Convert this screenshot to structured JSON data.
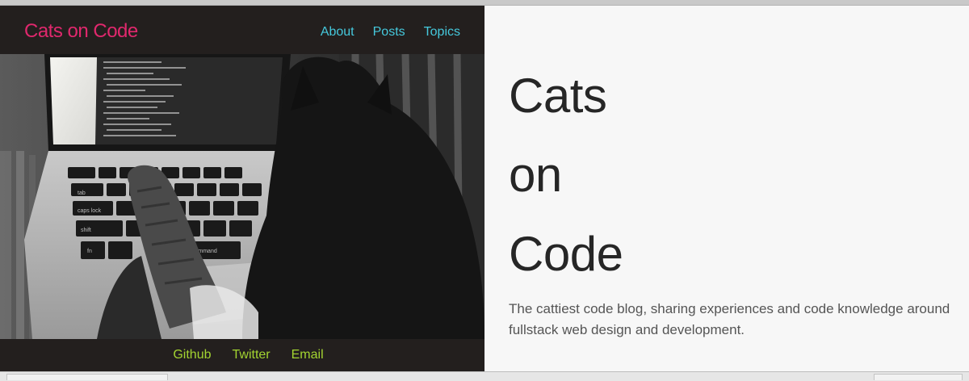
{
  "site": {
    "brand": "Cats on Code",
    "nav": [
      "About",
      "Posts",
      "Topics"
    ],
    "footer_links": [
      "Github",
      "Twitter",
      "Email"
    ],
    "title_words": [
      "Cats",
      "on",
      "Code"
    ],
    "tagline": "The cattiest code blog, sharing experiences and code knowledge around fullstack web design and development."
  },
  "colors": {
    "brand": "#e0286d",
    "nav_link": "#45c8dc",
    "footer_link": "#a3d431",
    "dark_panel": "#231f1e",
    "light_panel": "#f7f7f7"
  },
  "hero_image": {
    "keys": [
      "tab",
      "caps lock",
      "shift",
      "fn",
      "command"
    ]
  }
}
